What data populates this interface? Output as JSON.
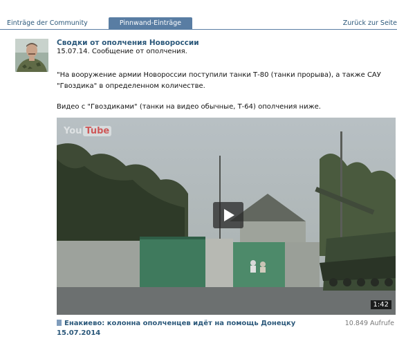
{
  "tabs": {
    "community": "Einträge der Community",
    "wall": "Pinnwand-Einträge",
    "back": "Zurück zur Seite"
  },
  "post": {
    "author": "Сводки от ополчения Новороссии",
    "line1": "15.07.14. Сообщение от ополчения.",
    "line2": "\"На вооружение армии Новороссии поступили танки Т-80 (танки прорыва), а также САУ",
    "line3": "\"Гвоздика\" в определенном количестве.",
    "line4": "Видео с \"Гвоздиками\" (танки на видео обычные, Т-64) ополчения ниже."
  },
  "video": {
    "logo_you": "You",
    "logo_tube": "Tube",
    "duration": "1:42",
    "title": "Енакиево: колонна ополченцев идёт на помощь Донецку",
    "date": "15.07.2014",
    "views": "10.849 Aufrufe"
  },
  "icons": {
    "play": "play-icon",
    "video": "video-icon"
  },
  "colors": {
    "link": "#2b587a",
    "active_tab": "#597da3",
    "muted": "#777777"
  }
}
